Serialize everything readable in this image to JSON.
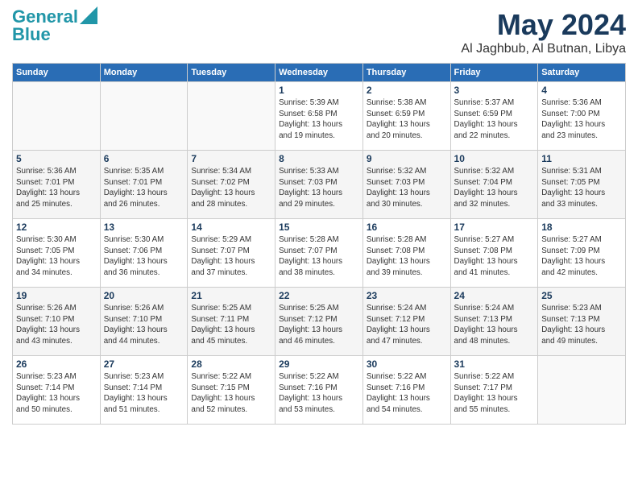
{
  "header": {
    "logo_line1": "General",
    "logo_line2": "Blue",
    "title": "May 2024",
    "location": "Al Jaghbub, Al Butnan, Libya"
  },
  "days_of_week": [
    "Sunday",
    "Monday",
    "Tuesday",
    "Wednesday",
    "Thursday",
    "Friday",
    "Saturday"
  ],
  "weeks": [
    [
      {
        "day": "",
        "info": ""
      },
      {
        "day": "",
        "info": ""
      },
      {
        "day": "",
        "info": ""
      },
      {
        "day": "1",
        "info": "Sunrise: 5:39 AM\nSunset: 6:58 PM\nDaylight: 13 hours\nand 19 minutes."
      },
      {
        "day": "2",
        "info": "Sunrise: 5:38 AM\nSunset: 6:59 PM\nDaylight: 13 hours\nand 20 minutes."
      },
      {
        "day": "3",
        "info": "Sunrise: 5:37 AM\nSunset: 6:59 PM\nDaylight: 13 hours\nand 22 minutes."
      },
      {
        "day": "4",
        "info": "Sunrise: 5:36 AM\nSunset: 7:00 PM\nDaylight: 13 hours\nand 23 minutes."
      }
    ],
    [
      {
        "day": "5",
        "info": "Sunrise: 5:36 AM\nSunset: 7:01 PM\nDaylight: 13 hours\nand 25 minutes."
      },
      {
        "day": "6",
        "info": "Sunrise: 5:35 AM\nSunset: 7:01 PM\nDaylight: 13 hours\nand 26 minutes."
      },
      {
        "day": "7",
        "info": "Sunrise: 5:34 AM\nSunset: 7:02 PM\nDaylight: 13 hours\nand 28 minutes."
      },
      {
        "day": "8",
        "info": "Sunrise: 5:33 AM\nSunset: 7:03 PM\nDaylight: 13 hours\nand 29 minutes."
      },
      {
        "day": "9",
        "info": "Sunrise: 5:32 AM\nSunset: 7:03 PM\nDaylight: 13 hours\nand 30 minutes."
      },
      {
        "day": "10",
        "info": "Sunrise: 5:32 AM\nSunset: 7:04 PM\nDaylight: 13 hours\nand 32 minutes."
      },
      {
        "day": "11",
        "info": "Sunrise: 5:31 AM\nSunset: 7:05 PM\nDaylight: 13 hours\nand 33 minutes."
      }
    ],
    [
      {
        "day": "12",
        "info": "Sunrise: 5:30 AM\nSunset: 7:05 PM\nDaylight: 13 hours\nand 34 minutes."
      },
      {
        "day": "13",
        "info": "Sunrise: 5:30 AM\nSunset: 7:06 PM\nDaylight: 13 hours\nand 36 minutes."
      },
      {
        "day": "14",
        "info": "Sunrise: 5:29 AM\nSunset: 7:07 PM\nDaylight: 13 hours\nand 37 minutes."
      },
      {
        "day": "15",
        "info": "Sunrise: 5:28 AM\nSunset: 7:07 PM\nDaylight: 13 hours\nand 38 minutes."
      },
      {
        "day": "16",
        "info": "Sunrise: 5:28 AM\nSunset: 7:08 PM\nDaylight: 13 hours\nand 39 minutes."
      },
      {
        "day": "17",
        "info": "Sunrise: 5:27 AM\nSunset: 7:08 PM\nDaylight: 13 hours\nand 41 minutes."
      },
      {
        "day": "18",
        "info": "Sunrise: 5:27 AM\nSunset: 7:09 PM\nDaylight: 13 hours\nand 42 minutes."
      }
    ],
    [
      {
        "day": "19",
        "info": "Sunrise: 5:26 AM\nSunset: 7:10 PM\nDaylight: 13 hours\nand 43 minutes."
      },
      {
        "day": "20",
        "info": "Sunrise: 5:26 AM\nSunset: 7:10 PM\nDaylight: 13 hours\nand 44 minutes."
      },
      {
        "day": "21",
        "info": "Sunrise: 5:25 AM\nSunset: 7:11 PM\nDaylight: 13 hours\nand 45 minutes."
      },
      {
        "day": "22",
        "info": "Sunrise: 5:25 AM\nSunset: 7:12 PM\nDaylight: 13 hours\nand 46 minutes."
      },
      {
        "day": "23",
        "info": "Sunrise: 5:24 AM\nSunset: 7:12 PM\nDaylight: 13 hours\nand 47 minutes."
      },
      {
        "day": "24",
        "info": "Sunrise: 5:24 AM\nSunset: 7:13 PM\nDaylight: 13 hours\nand 48 minutes."
      },
      {
        "day": "25",
        "info": "Sunrise: 5:23 AM\nSunset: 7:13 PM\nDaylight: 13 hours\nand 49 minutes."
      }
    ],
    [
      {
        "day": "26",
        "info": "Sunrise: 5:23 AM\nSunset: 7:14 PM\nDaylight: 13 hours\nand 50 minutes."
      },
      {
        "day": "27",
        "info": "Sunrise: 5:23 AM\nSunset: 7:14 PM\nDaylight: 13 hours\nand 51 minutes."
      },
      {
        "day": "28",
        "info": "Sunrise: 5:22 AM\nSunset: 7:15 PM\nDaylight: 13 hours\nand 52 minutes."
      },
      {
        "day": "29",
        "info": "Sunrise: 5:22 AM\nSunset: 7:16 PM\nDaylight: 13 hours\nand 53 minutes."
      },
      {
        "day": "30",
        "info": "Sunrise: 5:22 AM\nSunset: 7:16 PM\nDaylight: 13 hours\nand 54 minutes."
      },
      {
        "day": "31",
        "info": "Sunrise: 5:22 AM\nSunset: 7:17 PM\nDaylight: 13 hours\nand 55 minutes."
      },
      {
        "day": "",
        "info": ""
      }
    ]
  ]
}
